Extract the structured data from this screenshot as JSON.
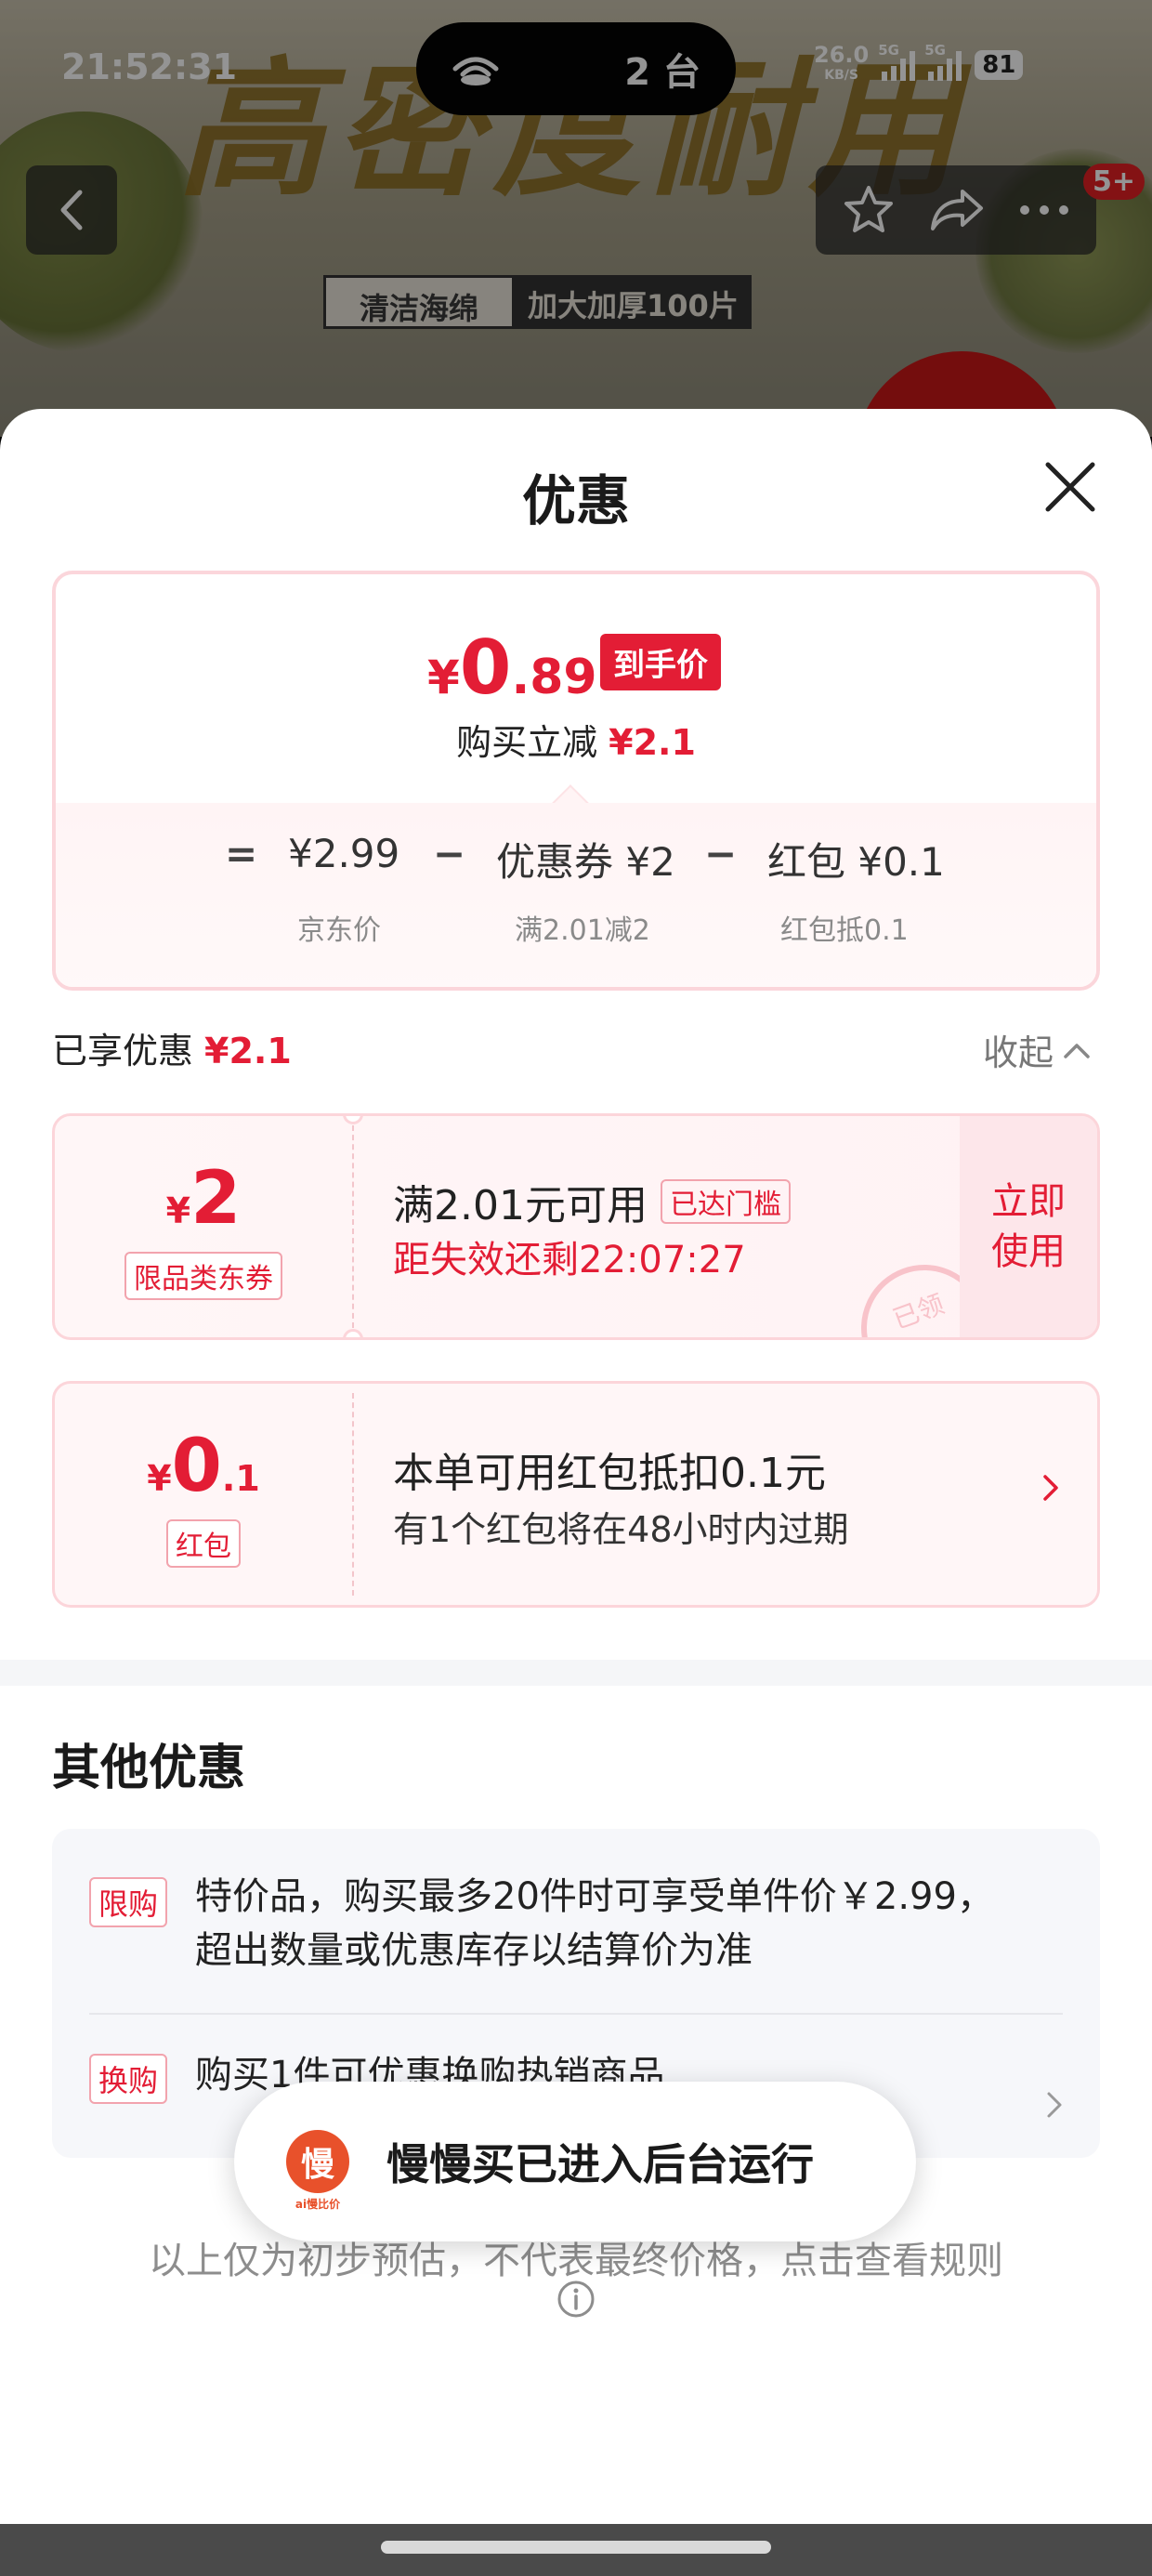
{
  "status_bar": {
    "time": "21:52:31",
    "island_count": "2 台",
    "net_speed": "26.0",
    "net_unit": "KB/S",
    "network1": "5G",
    "network2": "5G",
    "battery": "81"
  },
  "background": {
    "headline": "高密度耐用",
    "tag1": "清洁海绵",
    "tag2": "加大加厚100片",
    "badge": "5+"
  },
  "sheet": {
    "title": "优惠",
    "price": {
      "symbol": "¥",
      "integer": "0",
      "decimal": ".89",
      "tag": "到手价",
      "cut_label": "购买立减",
      "cut_value": "¥2.1"
    },
    "formula": {
      "eq": "=",
      "base": "¥2.99",
      "minus1": "−",
      "coupon": "优惠券 ¥2",
      "minus2": "−",
      "redpacket": "红包 ¥0.1",
      "base_label": "京东价",
      "coupon_label": "满2.01减2",
      "redpacket_label": "红包抵0.1"
    },
    "enjoyed": {
      "label": "已享优惠",
      "value": "¥2.1",
      "collapse": "收起"
    },
    "coupon1": {
      "symbol": "¥",
      "amount": "2",
      "kind": "限品类东券",
      "condition": "满2.01元可用",
      "reached": "已达门槛",
      "expire": "距失效还剩22:07:27",
      "use_now": "立即使用",
      "stamp": "已领"
    },
    "coupon2": {
      "symbol": "¥",
      "amount": "0",
      "decimal": ".1",
      "kind": "红包",
      "line1": "本单可用红包抵扣0.1元",
      "line2": "有1个红包将在48小时内过期"
    },
    "other": {
      "title": "其他优惠",
      "items": [
        {
          "tag": "限购",
          "text": "特价品，购买最多20件时可享受单件价￥2.99，超出数量或优惠库存以结算价为准"
        },
        {
          "tag": "换购",
          "text": "购买1件可优惠换购热销商品"
        }
      ]
    },
    "disclaimer": "以上仅为初步预估，不代表最终价格，点击查看规则"
  },
  "toast": {
    "logo_char": "慢",
    "logo_sub": "ai慢比价",
    "text": "慢慢买已进入后台运行"
  },
  "colors": {
    "accent_red": "#e31d35",
    "card_border": "#fbd6db"
  }
}
